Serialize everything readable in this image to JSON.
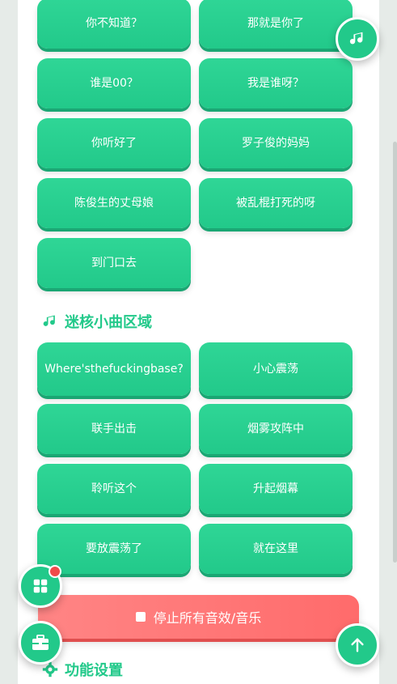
{
  "top_buttons": [
    "你不知道？",
    "那就是你了",
    "谁是00？",
    "我是谁呀？",
    "你听好了",
    "罗子俊的妈妈",
    "陈俊生的丈母娘",
    "被乱棍打死的呀",
    "到门口去"
  ],
  "section_music": {
    "title": "迷核小曲区域",
    "icon": "music-note-icon"
  },
  "music_buttons": [
    "Where'sthefuckingbase?",
    "小心震荡",
    "联手出击",
    "烟雾攻阵中",
    "聆听这个",
    "升起烟幕",
    "要放震荡了",
    "就在这里"
  ],
  "stop_button": {
    "label": "停止所有音效/音乐",
    "icon": "stop-icon"
  },
  "section_settings": {
    "title": "功能设置",
    "icon": "gear-icon"
  },
  "fabs": {
    "music": {
      "icon": "music-note-icon"
    },
    "grid": {
      "icon": "grid-icon",
      "has_badge": true
    },
    "toolbox": {
      "icon": "toolbox-icon"
    },
    "scroll_top": {
      "icon": "arrow-up-icon"
    }
  },
  "colors": {
    "accent": "#22c98a",
    "danger": "#ff6b6b",
    "badge": "#f04a4a"
  }
}
